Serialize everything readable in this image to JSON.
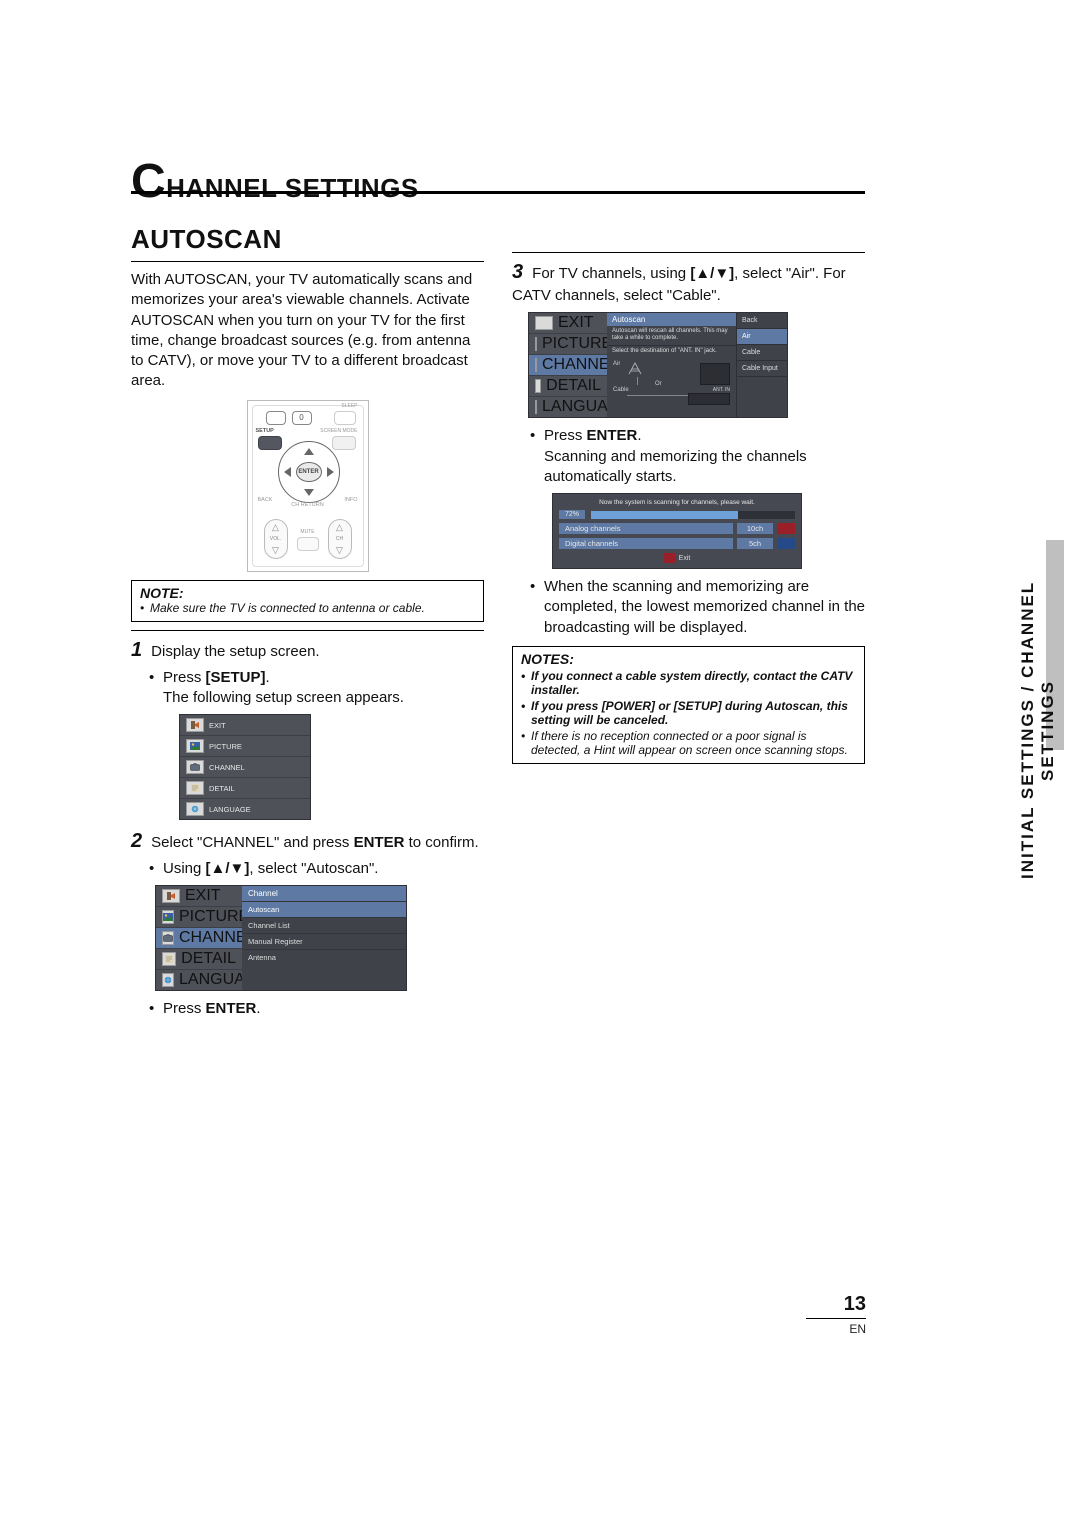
{
  "header": {
    "chapter": "HANNEL SETTINGS",
    "dropcap": "C"
  },
  "side_label": "INITIAL SETTINGS / CHANNEL SETTINGS",
  "page_number": "13",
  "page_lang": "EN",
  "left": {
    "section_title": "AUTOSCAN",
    "intro": "With AUTOSCAN, your TV automatically scans and memorizes your area's viewable channels. Activate AUTOSCAN when you turn on your TV for the first time, change broadcast sources (e.g. from antenna to CATV), or move your TV to a different broadcast area.",
    "remote": {
      "btn_zero": "0",
      "enter": "ENTER",
      "setup": "SETUP",
      "sleep": "SLEEP",
      "screen_mode": "SCREEN MODE",
      "back": "BACK",
      "info": "INFO",
      "ch_return": "CH RETURN",
      "vol": "VOL.",
      "ch": "CH",
      "mute": "MUTE"
    },
    "note_title": "NOTE:",
    "note_text": "Make sure the TV is connected to antenna or cable.",
    "step1_num": "1",
    "step1_text": "Display the setup screen.",
    "step1_press": "Press ",
    "step1_btn": "[SETUP]",
    "step1_post": ".",
    "step1_followup": "The following setup screen appears.",
    "osd_items": {
      "exit": "EXIT",
      "picture": "PICTURE",
      "channel": "CHANNEL",
      "detail": "DETAIL",
      "language": "LANGUAGE"
    },
    "step2_num": "2",
    "step2_text_a": "Select \"CHANNEL\" and press ",
    "step2_btn": "ENTER",
    "step2_text_b": " to confirm.",
    "step2_using_a": "Using ",
    "step2_arrows": "[▲/▼]",
    "step2_using_b": ", select \"Autoscan\".",
    "channel_panel_title": "Channel",
    "channel_panel_items": {
      "autoscan": "Autoscan",
      "channel_list": "Channel List",
      "manual_register": "Manual Register",
      "antenna": "Antenna"
    },
    "press_enter_a": "Press ",
    "press_enter_b": "ENTER",
    "press_enter_c": "."
  },
  "right": {
    "step3_num": "3",
    "step3_a": "For TV channels, using ",
    "step3_arrows": "[▲/▼]",
    "step3_b": ", select \"Air\". For CATV channels, select \"Cable\".",
    "autoscan_fig": {
      "title": "Autoscan",
      "hint1": "Autoscan will rescan all channels. This may take a while to complete.",
      "hint2": "Select the destination of \"ANT. IN\" jack.",
      "air": "Air",
      "cable": "Cable",
      "or": "Or",
      "ant_in": "ANT. IN",
      "right_opts": {
        "back": "Back",
        "air": "Air",
        "cable": "Cable",
        "cable_input": "Cable Input"
      }
    },
    "press_enter_a": "Press ",
    "press_enter_b": "ENTER",
    "press_enter_c": ".",
    "press_enter_follow": "Scanning and memorizing the channels automatically starts.",
    "progress": {
      "msg": "Now the system is scanning for channels, please wait.",
      "pct": "72%",
      "analog_k": "Analog channels",
      "analog_v": "10ch",
      "digital_k": "Digital channels",
      "digital_v": "5ch",
      "exit": "Exit"
    },
    "after": "When the scanning and memorizing are completed, the lowest memorized channel in the broadcasting will be displayed.",
    "notes_title": "NOTES:",
    "notes": {
      "n1": "If you connect a cable system directly, contact the CATV installer.",
      "n2": "If you press [POWER] or [SETUP] during Autoscan, this setting will be canceled.",
      "n3": "If there is no reception connected or a poor signal is detected, a Hint will appear on screen once scanning stops."
    }
  }
}
